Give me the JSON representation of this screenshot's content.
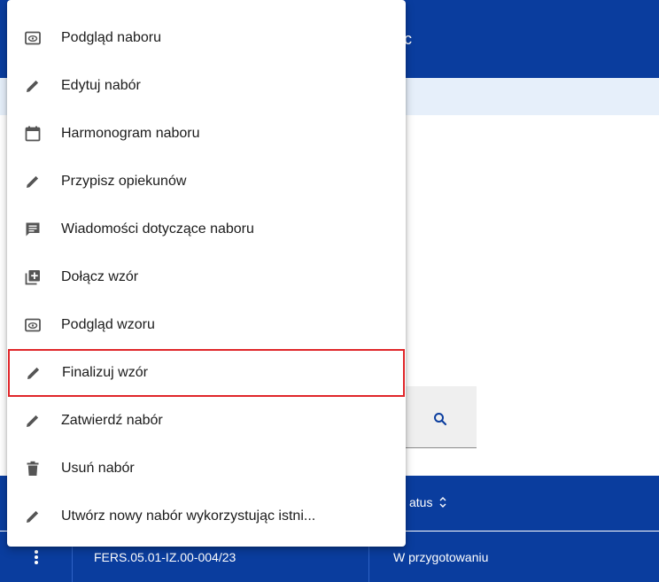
{
  "header": {
    "title_fragment": "c"
  },
  "table": {
    "status_header": "atus",
    "rows": [
      {
        "code": "FERS.05.01-IZ.00-004/23",
        "status": "W przygotowaniu"
      }
    ]
  },
  "menu": {
    "items": [
      {
        "label": "Podgląd naboru",
        "icon": "preview-icon"
      },
      {
        "label": "Edytuj nabór",
        "icon": "pencil-icon"
      },
      {
        "label": "Harmonogram naboru",
        "icon": "calendar-icon"
      },
      {
        "label": "Przypisz opiekunów",
        "icon": "pencil-icon"
      },
      {
        "label": "Wiadomości dotyczące naboru",
        "icon": "message-icon"
      },
      {
        "label": "Dołącz wzór",
        "icon": "add-library-icon"
      },
      {
        "label": "Podgląd wzoru",
        "icon": "preview-icon"
      },
      {
        "label": "Finalizuj wzór",
        "icon": "pencil-icon"
      },
      {
        "label": "Zatwierdź nabór",
        "icon": "pencil-icon"
      },
      {
        "label": "Usuń nabór",
        "icon": "trash-icon"
      },
      {
        "label": "Utwórz nowy nabór wykorzystując istni...",
        "icon": "pencil-icon"
      }
    ],
    "highlighted_index": 7
  },
  "colors": {
    "primary": "#0a3d9e",
    "info_band": "#e6effa",
    "highlight_border": "#e0262a"
  }
}
